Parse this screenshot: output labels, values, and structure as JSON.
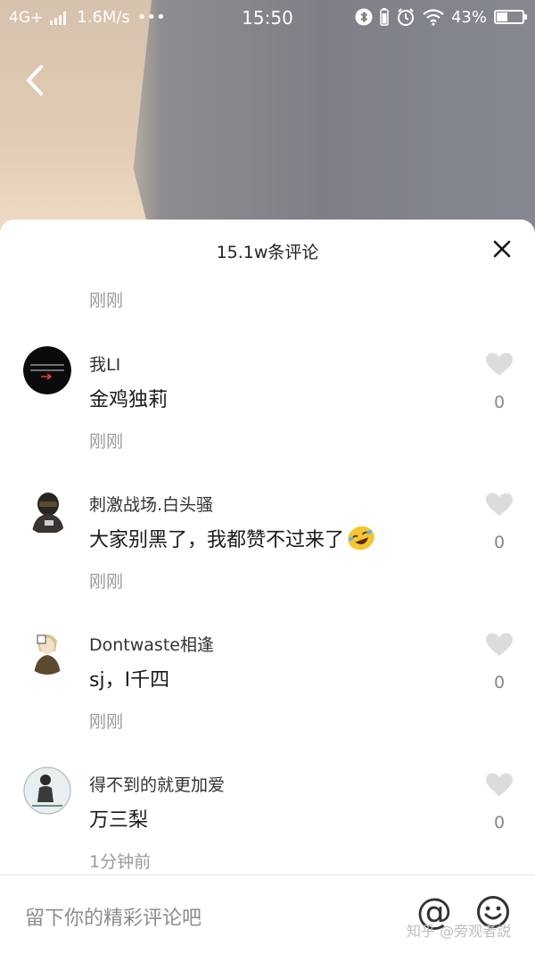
{
  "status_bar": {
    "network": "4G+",
    "speed": "1.6M/s",
    "dots": "•••",
    "time": "15:50",
    "battery": "43%",
    "battery_level": 0.43
  },
  "sheet": {
    "title": "15.1w条评论",
    "top_time": "刚刚"
  },
  "comments": [
    {
      "name": "我LI",
      "text": "金鸡独莉",
      "time": "刚刚",
      "likes": "0",
      "avatar": "dark-avatar"
    },
    {
      "name": "刺激战场.白头骚",
      "text": "大家别黑了，我都赞不过来了",
      "emoji": "laughing-crying-emoji",
      "time": "刚刚",
      "likes": "0",
      "avatar": "helmet-avatar"
    },
    {
      "name": "Dontwaste相逢",
      "text": "sj，I千四",
      "time": "刚刚",
      "likes": "0",
      "avatar": "anime-avatar"
    },
    {
      "name": "得不到的就更加爱",
      "text": "万三梨",
      "time": "1分钟前",
      "likes": "0",
      "avatar": "sketch-avatar"
    }
  ],
  "input": {
    "placeholder": "留下你的精彩评论吧",
    "at_symbol": "@"
  },
  "watermark": "知乎 @旁观者説",
  "colors": {
    "text_primary": "#1a1a1a",
    "text_secondary": "#9a9a9a",
    "like_grey": "#dcdcdc"
  }
}
